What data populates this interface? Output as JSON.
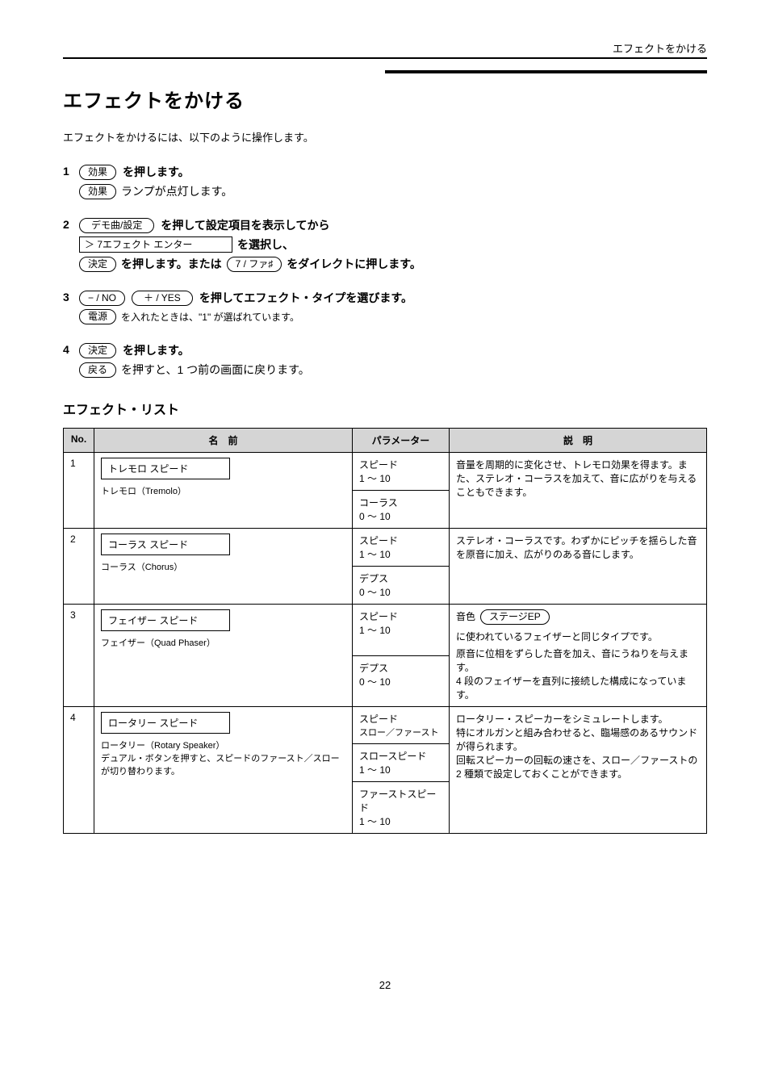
{
  "header": {
    "right_label": "エフェクトをかける"
  },
  "section": {
    "title": "エフェクトをかける",
    "subtitle": "エフェクトをかけるには、以下のように操作します。"
  },
  "steps": [
    {
      "num": "1",
      "lines": [
        {
          "type": "pill",
          "key": "効果"
        },
        {
          "type": "text_with_trailing_pill",
          "text": "を押します。",
          "trail_label": "ランプが点灯します。",
          "trail_pill_before": "効果",
          "plain_prefix": ""
        }
      ],
      "rendered": {
        "pill": "効果",
        "text1": " を押します。",
        "pill2": "効果",
        "text2": " ランプが点灯します。"
      }
    },
    {
      "num": "2",
      "rendered": {
        "pill1": "デモ曲/設定",
        "text1": " を押して設定項目を表示してから",
        "rect": "＞ 7エフェクト      エンター",
        "text2": " を選択し、",
        "pill2": "決定",
        "text3": " を押します。または ",
        "pill3": "7 / ファ♯",
        "text4": " をダイレクトに押します。"
      }
    },
    {
      "num": "3",
      "rendered": {
        "pill1": "− / NO",
        "pill2": "＋ / YES",
        "text": " を押してエフェクト・タイプを選びます。",
        "note_pill": "電源",
        "note_text": " を入れたときは、\"1\" が選ばれています。"
      }
    },
    {
      "num": "4",
      "rendered": {
        "pill1": "決定",
        "text1": " を押します。",
        "pill2": "戻る",
        "text2": " を押すと、1 つ前の画面に戻ります。"
      }
    }
  ],
  "list": {
    "title": "エフェクト・リスト",
    "columns": [
      "No.",
      "名　前",
      "パラメーター",
      "説　明"
    ],
    "rows": [
      {
        "no": "1",
        "name_box": "トレモロ          スピード",
        "name_sub": "トレモロ（Tremolo）",
        "params": [
          {
            "label": "スピード",
            "range": "1 〜 10"
          },
          {
            "label": "コーラス",
            "range": "0 〜 10"
          }
        ],
        "desc": "音量を周期的に変化させ、トレモロ効果を得ます。また、ステレオ・コーラスを加えて、音に広がりを与えることもできます。"
      },
      {
        "no": "2",
        "name_box": "コーラス          スピード",
        "name_sub": "コーラス（Chorus）",
        "params": [
          {
            "label": "スピード",
            "range": "1 〜 10"
          },
          {
            "label": "デプス",
            "range": "0 〜 10"
          }
        ],
        "desc": "ステレオ・コーラスです。わずかにピッチを揺らした音を原音に加え、広がりのある音にします。"
      },
      {
        "no": "3",
        "name_box": "フェイザー        スピード",
        "name_sub": "フェイザー（Quad Phaser）",
        "params": [
          {
            "label": "スピード",
            "range": "1 〜 10"
          },
          {
            "label": "デプス",
            "range": "0 〜 10"
          }
        ],
        "desc": {
          "line1_before": "音色 ",
          "pill": "ステージEP",
          "line1_after": " に使われているフェイザーと同じタイプです。",
          "line2": "原音に位相をずらした音を加え、音にうねりを与えます。",
          "line3": "4 段のフェイザーを直列に接続した構成になっています。"
        }
      },
      {
        "no": "4",
        "name_box": "ロータリー        スピード",
        "name_sub": "ロータリー（Rotary Speaker）\nデュアル・ボタンを押すと、スピードのファースト／スローが切り替わります。",
        "params": [
          {
            "label": "スピード",
            "range": "スロー／ファースト"
          },
          {
            "label": "スロースピード",
            "range": "1 〜 10"
          },
          {
            "label": "ファーストスピード",
            "range": "1 〜 10"
          }
        ],
        "desc": "ロータリー・スピーカーをシミュレートします。\n特にオルガンと組み合わせると、臨場感のあるサウンドが得られます。\n回転スピーカーの回転の速さを、スロー／ファーストの 2 種類で設定しておくことができます。"
      }
    ]
  },
  "page_number": "22"
}
